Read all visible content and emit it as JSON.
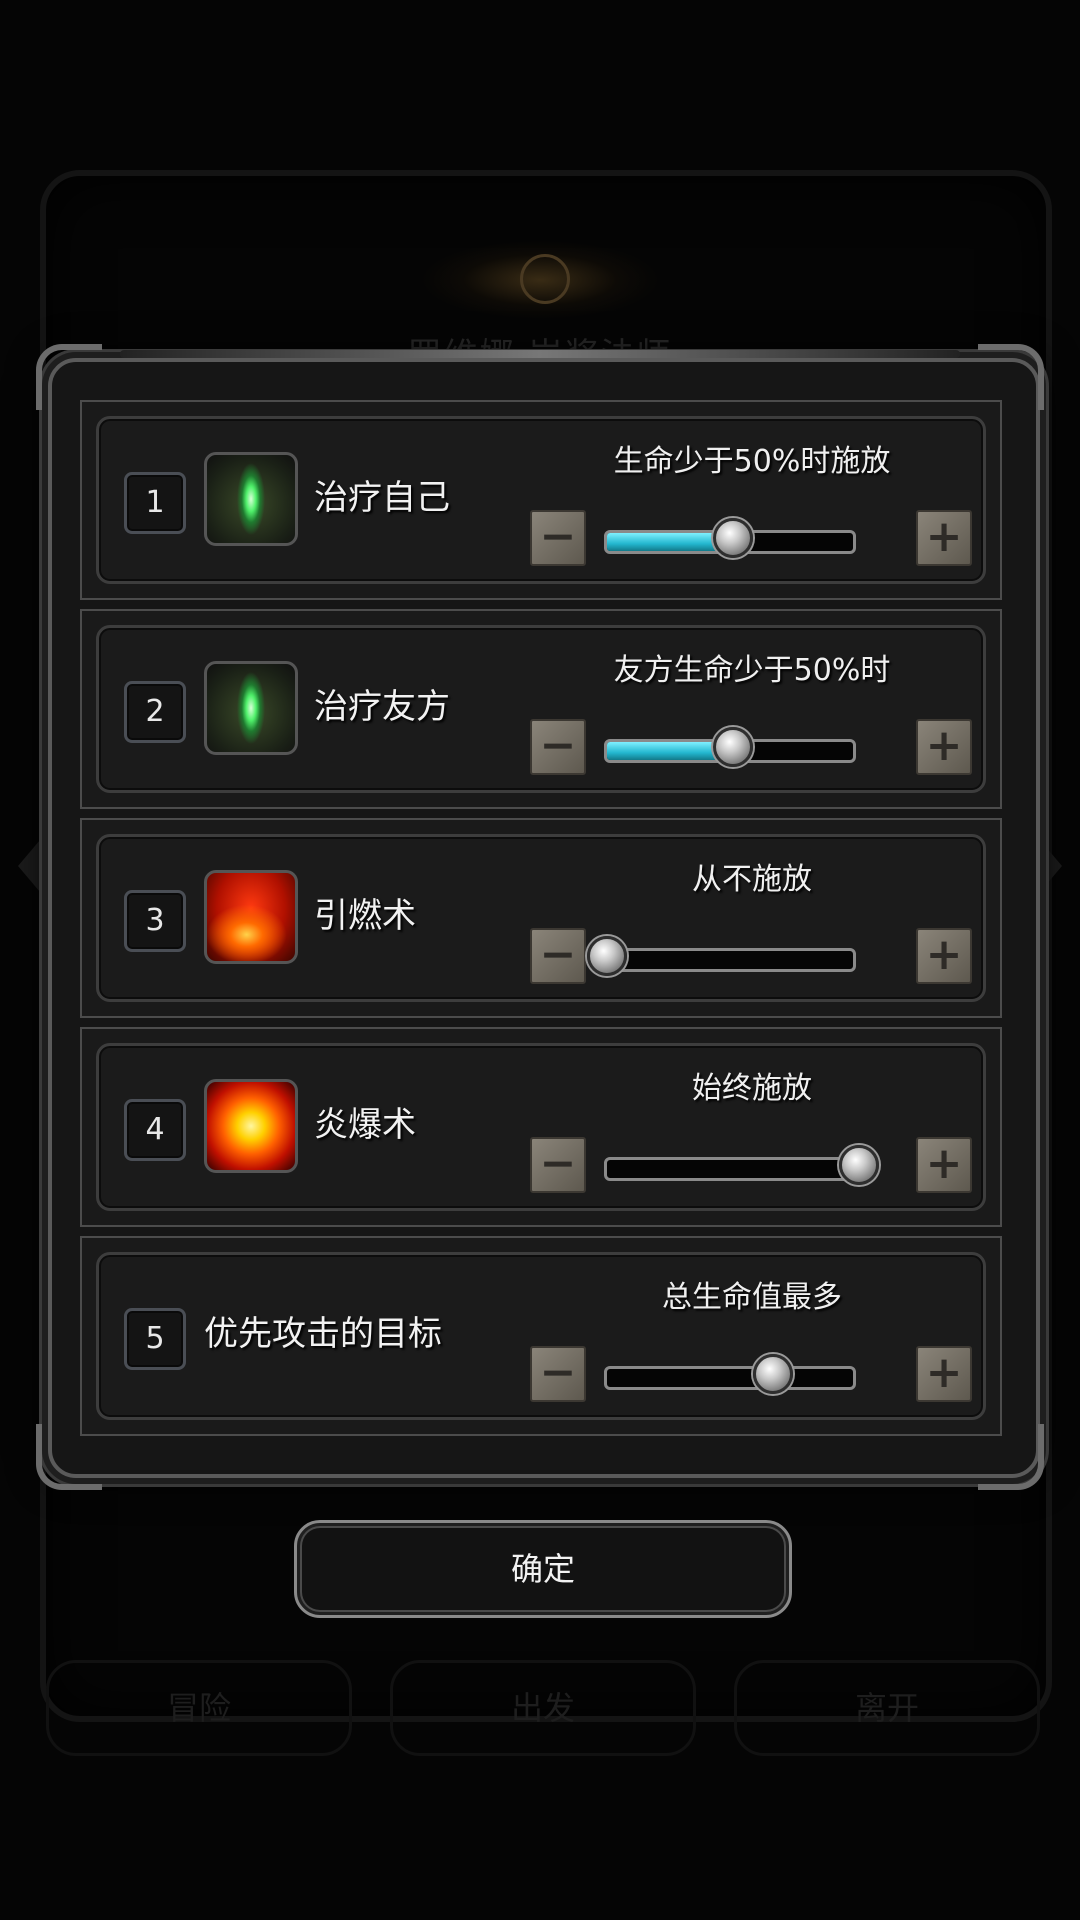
{
  "background": {
    "title": "罗维娜 岩浆法师",
    "nav": [
      "冒险",
      "出发",
      "离开"
    ]
  },
  "rows": [
    {
      "num": "1",
      "icon": "heal-skill-icon",
      "name": "治疗自己",
      "condition": "生命少于50%时施放",
      "level": 0.5,
      "filled": true
    },
    {
      "num": "2",
      "icon": "heal-skill-icon",
      "name": "治疗友方",
      "condition": "友方生命少于50%时",
      "level": 0.5,
      "filled": true
    },
    {
      "num": "3",
      "icon": "ignite-skill-icon",
      "name": "引燃术",
      "condition": "从不施放",
      "level": 0.0,
      "filled": false
    },
    {
      "num": "4",
      "icon": "fire-blast-skill-icon",
      "name": "炎爆术",
      "condition": "始终施放",
      "level": 1.0,
      "filled": false
    },
    {
      "num": "5",
      "icon": "",
      "name": "优先攻击的目标",
      "condition": "总生命值最多",
      "level": 0.66,
      "filled": false
    }
  ],
  "buttons": {
    "minus_symbol": "−",
    "plus_symbol": "+",
    "confirm_label": "确定"
  },
  "colors": {
    "slider_fill": "#23b7cf",
    "panel_bg": "#1a1a1a",
    "frame": "#5a5a5a"
  }
}
